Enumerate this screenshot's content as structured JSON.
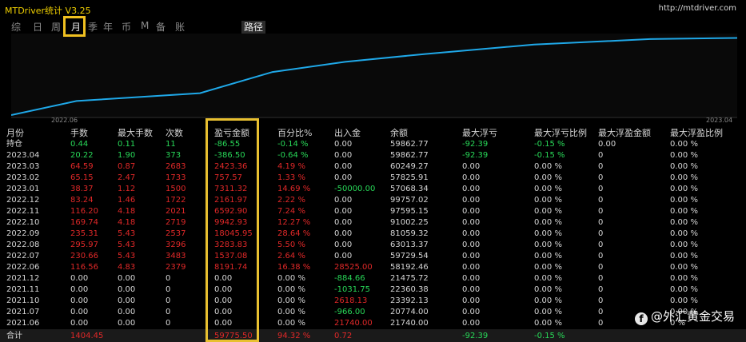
{
  "window": {
    "title": "MTDriver统计 V3.25",
    "url": "http://mtdriver.com"
  },
  "tabs": [
    "综",
    "日",
    "周",
    "月",
    "季",
    "年",
    "币",
    "M",
    "备",
    "账户"
  ],
  "active_tab": "月",
  "path_tab": "路径",
  "chart": {
    "x_labels": [
      "2022.06",
      "2023.04"
    ],
    "line_color": "#1fa8e8",
    "points": [
      [
        0.0,
        0.0
      ],
      [
        0.09,
        0.18
      ],
      [
        0.26,
        0.28
      ],
      [
        0.36,
        0.55
      ],
      [
        0.46,
        0.68
      ],
      [
        0.57,
        0.78
      ],
      [
        0.72,
        0.9
      ],
      [
        0.88,
        0.97
      ],
      [
        1.0,
        0.985
      ]
    ]
  },
  "table": {
    "headers": [
      "月份",
      "手数",
      "最大手数",
      "次数",
      "盈亏金额",
      "百分比%",
      "出入金",
      "余额",
      "最大浮亏",
      "最大浮亏比例",
      "最大浮盈金额",
      "最大浮盈比例"
    ],
    "rows": [
      {
        "c": [
          "持仓",
          "0.44",
          "0.11",
          "11",
          "-86.55",
          "-0.14 %",
          "0.00",
          "59862.77",
          "-92.39",
          "-0.15 %",
          "0.00",
          "0.00 %"
        ],
        "k": [
          "w",
          "g",
          "g",
          "g",
          "g",
          "g",
          "w",
          "w",
          "g",
          "g",
          "w",
          "w"
        ]
      },
      {
        "c": [
          "2023.04",
          "20.22",
          "1.90",
          "373",
          "-386.50",
          "-0.64 %",
          "0.00",
          "59862.77",
          "-92.39",
          "-0.15 %",
          "0",
          "0.00 %"
        ],
        "k": [
          "w",
          "g",
          "g",
          "g",
          "g",
          "g",
          "w",
          "w",
          "g",
          "g",
          "w",
          "w"
        ]
      },
      {
        "c": [
          "2023.03",
          "64.59",
          "0.87",
          "2683",
          "2423.36",
          "4.19 %",
          "0.00",
          "60249.27",
          "0.00",
          "0.00 %",
          "0",
          "0.00 %"
        ],
        "k": [
          "w",
          "r",
          "r",
          "r",
          "r",
          "r",
          "w",
          "w",
          "w",
          "w",
          "w",
          "w"
        ]
      },
      {
        "c": [
          "2023.02",
          "65.15",
          "2.47",
          "1733",
          "757.57",
          "1.33 %",
          "0.00",
          "57825.91",
          "0.00",
          "0.00 %",
          "0",
          "0.00 %"
        ],
        "k": [
          "w",
          "r",
          "r",
          "r",
          "r",
          "r",
          "w",
          "w",
          "w",
          "w",
          "w",
          "w"
        ]
      },
      {
        "c": [
          "2023.01",
          "38.37",
          "1.12",
          "1500",
          "7311.32",
          "14.69 %",
          "-50000.00",
          "57068.34",
          "0.00",
          "0.00 %",
          "0",
          "0.00 %"
        ],
        "k": [
          "w",
          "r",
          "r",
          "r",
          "r",
          "r",
          "g",
          "w",
          "w",
          "w",
          "w",
          "w"
        ]
      },
      {
        "c": [
          "2022.12",
          "83.24",
          "1.46",
          "1722",
          "2161.97",
          "2.22 %",
          "0.00",
          "99757.02",
          "0.00",
          "0.00 %",
          "0",
          "0.00 %"
        ],
        "k": [
          "w",
          "r",
          "r",
          "r",
          "r",
          "r",
          "w",
          "w",
          "w",
          "w",
          "w",
          "w"
        ]
      },
      {
        "c": [
          "2022.11",
          "116.20",
          "4.18",
          "2021",
          "6592.90",
          "7.24 %",
          "0.00",
          "97595.15",
          "0.00",
          "0.00 %",
          "0",
          "0.00 %"
        ],
        "k": [
          "w",
          "r",
          "r",
          "r",
          "r",
          "r",
          "w",
          "w",
          "w",
          "w",
          "w",
          "w"
        ]
      },
      {
        "c": [
          "2022.10",
          "169.74",
          "4.18",
          "2719",
          "9942.93",
          "12.27 %",
          "0.00",
          "91002.25",
          "0.00",
          "0.00 %",
          "0",
          "0.00 %"
        ],
        "k": [
          "w",
          "r",
          "r",
          "r",
          "r",
          "r",
          "w",
          "w",
          "w",
          "w",
          "w",
          "w"
        ]
      },
      {
        "c": [
          "2022.09",
          "235.31",
          "5.43",
          "2537",
          "18045.95",
          "28.64 %",
          "0.00",
          "81059.32",
          "0.00",
          "0.00 %",
          "0",
          "0.00 %"
        ],
        "k": [
          "w",
          "r",
          "r",
          "r",
          "r",
          "r",
          "w",
          "w",
          "w",
          "w",
          "w",
          "w"
        ]
      },
      {
        "c": [
          "2022.08",
          "295.97",
          "5.43",
          "3296",
          "3283.83",
          "5.50 %",
          "0.00",
          "63013.37",
          "0.00",
          "0.00 %",
          "0",
          "0.00 %"
        ],
        "k": [
          "w",
          "r",
          "r",
          "r",
          "r",
          "r",
          "w",
          "w",
          "w",
          "w",
          "w",
          "w"
        ]
      },
      {
        "c": [
          "2022.07",
          "230.66",
          "5.43",
          "3483",
          "1537.08",
          "2.64 %",
          "0.00",
          "59729.54",
          "0.00",
          "0.00 %",
          "0",
          "0.00 %"
        ],
        "k": [
          "w",
          "r",
          "r",
          "r",
          "r",
          "r",
          "w",
          "w",
          "w",
          "w",
          "w",
          "w"
        ]
      },
      {
        "c": [
          "2022.06",
          "116.56",
          "4.83",
          "2379",
          "8191.74",
          "16.38 %",
          "28525.00",
          "58192.46",
          "0.00",
          "0.00 %",
          "0",
          "0.00 %"
        ],
        "k": [
          "w",
          "r",
          "r",
          "r",
          "r",
          "r",
          "r",
          "w",
          "w",
          "w",
          "w",
          "w"
        ]
      },
      {
        "c": [
          "2021.12",
          "0.00",
          "0.00",
          "0",
          "0.00",
          "0.00 %",
          "-884.66",
          "21475.72",
          "0.00",
          "0.00 %",
          "0",
          "0.00 %"
        ],
        "k": [
          "w",
          "w",
          "w",
          "w",
          "w",
          "w",
          "g",
          "w",
          "w",
          "w",
          "w",
          "w"
        ]
      },
      {
        "c": [
          "2021.11",
          "0.00",
          "0.00",
          "0",
          "0.00",
          "0.00 %",
          "-1031.75",
          "22360.38",
          "0.00",
          "0.00 %",
          "0",
          "0.00 %"
        ],
        "k": [
          "w",
          "w",
          "w",
          "w",
          "w",
          "w",
          "g",
          "w",
          "w",
          "w",
          "w",
          "w"
        ]
      },
      {
        "c": [
          "2021.10",
          "0.00",
          "0.00",
          "0",
          "0.00",
          "0.00 %",
          "2618.13",
          "23392.13",
          "0.00",
          "0.00 %",
          "0",
          "0.00 %"
        ],
        "k": [
          "w",
          "w",
          "w",
          "w",
          "w",
          "w",
          "r",
          "w",
          "w",
          "w",
          "w",
          "w"
        ]
      },
      {
        "c": [
          "2021.07",
          "0.00",
          "0.00",
          "0",
          "0.00",
          "0.00 %",
          "-966.00",
          "20774.00",
          "0.00",
          "0.00 %",
          "0",
          "0.00 %"
        ],
        "k": [
          "w",
          "w",
          "w",
          "w",
          "w",
          "w",
          "g",
          "w",
          "w",
          "w",
          "w",
          "w"
        ]
      },
      {
        "c": [
          "2021.06",
          "0.00",
          "0.00",
          "0",
          "0.00",
          "0.00 %",
          "21740.00",
          "21740.00",
          "0.00",
          "0.00 %",
          "0",
          "0 %"
        ],
        "k": [
          "w",
          "w",
          "w",
          "w",
          "w",
          "w",
          "r",
          "w",
          "w",
          "w",
          "w",
          "w"
        ]
      }
    ],
    "total": {
      "c": [
        "合计",
        "1404.45",
        "",
        "",
        "59775.50",
        "94.32 %",
        "0.72",
        "",
        "-92.39",
        "-0.15 %",
        "",
        ""
      ],
      "k": [
        "w",
        "r",
        "w",
        "w",
        "r",
        "r",
        "r",
        "w",
        "g",
        "g",
        "w",
        "w"
      ]
    }
  },
  "watermark": "@外汇黄金交易"
}
